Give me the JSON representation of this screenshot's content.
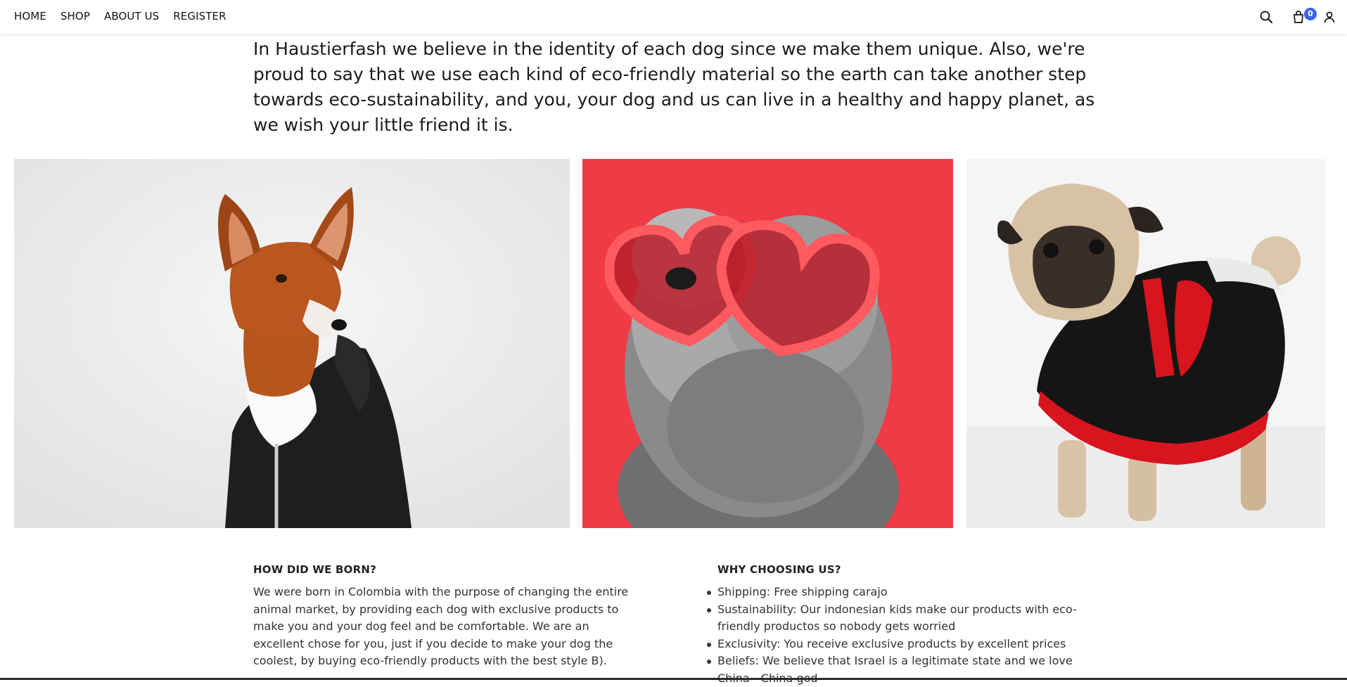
{
  "nav": {
    "links": [
      "HOME",
      "SHOP",
      "ABOUT US",
      "REGISTER"
    ],
    "icons": [
      "search-icon",
      "cart-icon",
      "user-icon"
    ],
    "cart_count": "0",
    "badge_color": "#3b63f0"
  },
  "intro": {
    "text": "In Haustierfash we believe in the identity of each dog since we make them unique. Also, we're proud to say that we use each kind of eco-friendly material so the earth can take another step towards eco-sustainability, and you, your dog and us can live in a healthy and happy planet, as we wish your little friend it is."
  },
  "gallery": [
    {
      "subject": "basenji-dog-in-black-hoodie",
      "background": "#eeeeee"
    },
    {
      "subject": "shih-tzu-with-heart-sunglasses",
      "background": "#f03a45"
    },
    {
      "subject": "pug-in-red-black-sweater",
      "background": "#f4f4f4"
    }
  ],
  "about": {
    "title": "HOW DID WE BORN?",
    "text": "We were born in Colombia with the purpose of changing the entire animal market, by providing each dog with exclusive products to make you and your dog feel and be comfortable. We are an excellent chose for you, just if you decide to make your dog the coolest, by buying eco-friendly products with the best style B)."
  },
  "why": {
    "title": "WHY CHOOSING US?",
    "items": [
      "Shipping: Free shipping carajo",
      "Sustainability: Our indonesian kids make our products with eco-friendly productos so nobody gets worried",
      "Exclusivity: You receive exclusive products by excellent prices",
      "Beliefs: We believe that Israel is a legitimate state and we love China - China god"
    ]
  }
}
